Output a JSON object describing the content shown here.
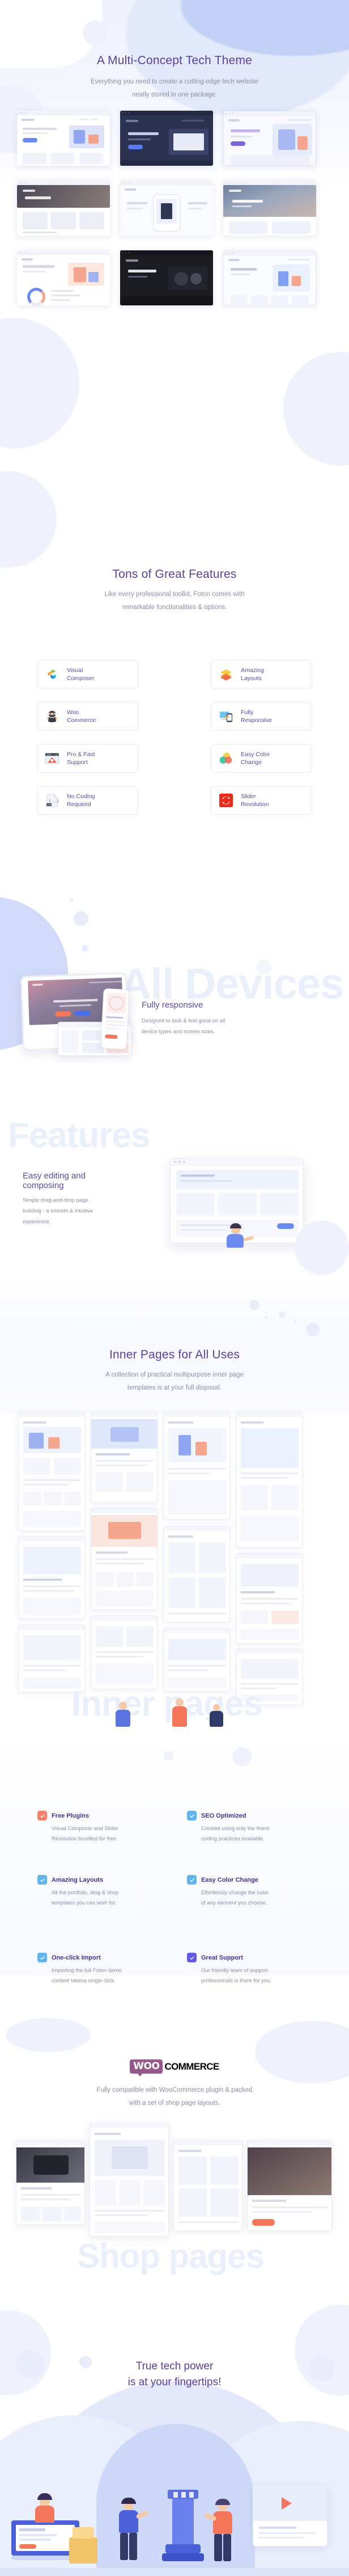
{
  "colors": {
    "heading": "#5a3f9e",
    "body_text": "#8d8da6",
    "accent_purple": "#6148a8",
    "accent_blue": "#5aade8",
    "accent_coral": "#f5836b",
    "accent_indigo": "#6c5ce7",
    "watermark": "#eaeffc",
    "card_border": "#e3e9f8",
    "woo_purple": "#96588a"
  },
  "hero": {
    "title": "A Multi-Concept Tech Theme",
    "subtitle_line1": "Everything you need to create a cutting-edge tech website",
    "subtitle_line2": "neatly stored in one package."
  },
  "hero_gallery": {
    "items": [
      {
        "name": "demo-thumb-1"
      },
      {
        "name": "demo-thumb-2"
      },
      {
        "name": "demo-thumb-3"
      },
      {
        "name": "demo-thumb-4"
      },
      {
        "name": "demo-thumb-5"
      },
      {
        "name": "demo-thumb-6"
      },
      {
        "name": "demo-thumb-7"
      },
      {
        "name": "demo-thumb-8"
      },
      {
        "name": "demo-thumb-9"
      }
    ]
  },
  "features": {
    "title": "Tons of Great Features",
    "subtitle_line1": "Like every professional toolkit, Foton comes with",
    "subtitle_line2": "remarkable functionalities & options.",
    "cards": [
      {
        "label_line1": "Visual",
        "label_line2": "Composer",
        "icon": "visual-composer-icon"
      },
      {
        "label_line1": "Amazing",
        "label_line2": "Layouts",
        "icon": "layers-icon"
      },
      {
        "label_line1": "Woo",
        "label_line2": "Commerce",
        "icon": "woocommerce-ninja-icon"
      },
      {
        "label_line1": "Fully",
        "label_line2": "Responsive",
        "icon": "responsive-devices-icon"
      },
      {
        "label_line1": "Pro & Fast",
        "label_line2": "Support",
        "icon": "support-browser-gear-icon"
      },
      {
        "label_line1": "Easy Color",
        "label_line2": "Change",
        "icon": "color-circles-icon"
      },
      {
        "label_line1": "No Coding",
        "label_line2": "Required",
        "icon": "css-file-icon"
      },
      {
        "label_line1": "Slider",
        "label_line2": "Revolution",
        "icon": "slider-revolution-icon"
      }
    ]
  },
  "devices": {
    "watermark": "All Devices",
    "title": "Fully responsive",
    "text_line1": "Designed to look & feel great on all",
    "text_line2": "device types and screen sizes."
  },
  "editing": {
    "watermark": "Features",
    "title_line1": "Easy editing and",
    "title_line2": "composing",
    "text_line1": "Simple drag-and-drop page",
    "text_line2": "building - a smooth & intuitive",
    "text_line3": "experience."
  },
  "inner_pages": {
    "title": "Inner Pages for All Uses",
    "subtitle_line1": "A collection of practical multipurpose inner page",
    "subtitle_line2": "templates is at your full disposal.",
    "watermark": "Inner pages"
  },
  "checklist": {
    "items": [
      {
        "title": "Free Plugins",
        "desc_line1": "Visual Composer and Slider",
        "desc_line2": "Revolution bundled for free.",
        "check_color": "#f5836b",
        "icon": "check-icon"
      },
      {
        "title": "SEO Optimized",
        "desc_line1": "Created using only the finest",
        "desc_line2": "coding practices available.",
        "check_color": "#62b4ef",
        "icon": "check-icon"
      },
      {
        "title": "Amazing Layouts",
        "desc_line1": "All the portfolio, blog & shop",
        "desc_line2": "templates you can wish for.",
        "check_color": "#62b4ef",
        "icon": "check-icon"
      },
      {
        "title": "Easy Color Change",
        "desc_line1": "Effortlessly change the color",
        "desc_line2": "of any element you choose.",
        "check_color": "#62b4ef",
        "icon": "check-icon"
      },
      {
        "title": "One-click Import",
        "desc_line1": "Importing the full Foton demo",
        "desc_line2": "content takesa single click.",
        "check_color": "#62b4ef",
        "icon": "check-icon"
      },
      {
        "title": "Great Support",
        "desc_line1": "Our friendly team of support",
        "desc_line2": "professionals is there for you.",
        "check_color": "#6457e8",
        "icon": "check-icon"
      }
    ]
  },
  "woocommerce": {
    "logo_badge": "WOO",
    "logo_word": "COMMERCE",
    "text_line1": "Fully compatible with WooCommerce plugin & packed",
    "text_line2": "with a set of shop page layouts.",
    "watermark": "Shop pages"
  },
  "footer": {
    "title_line1": "True tech power",
    "title_line2": "is at your fingertips!"
  }
}
